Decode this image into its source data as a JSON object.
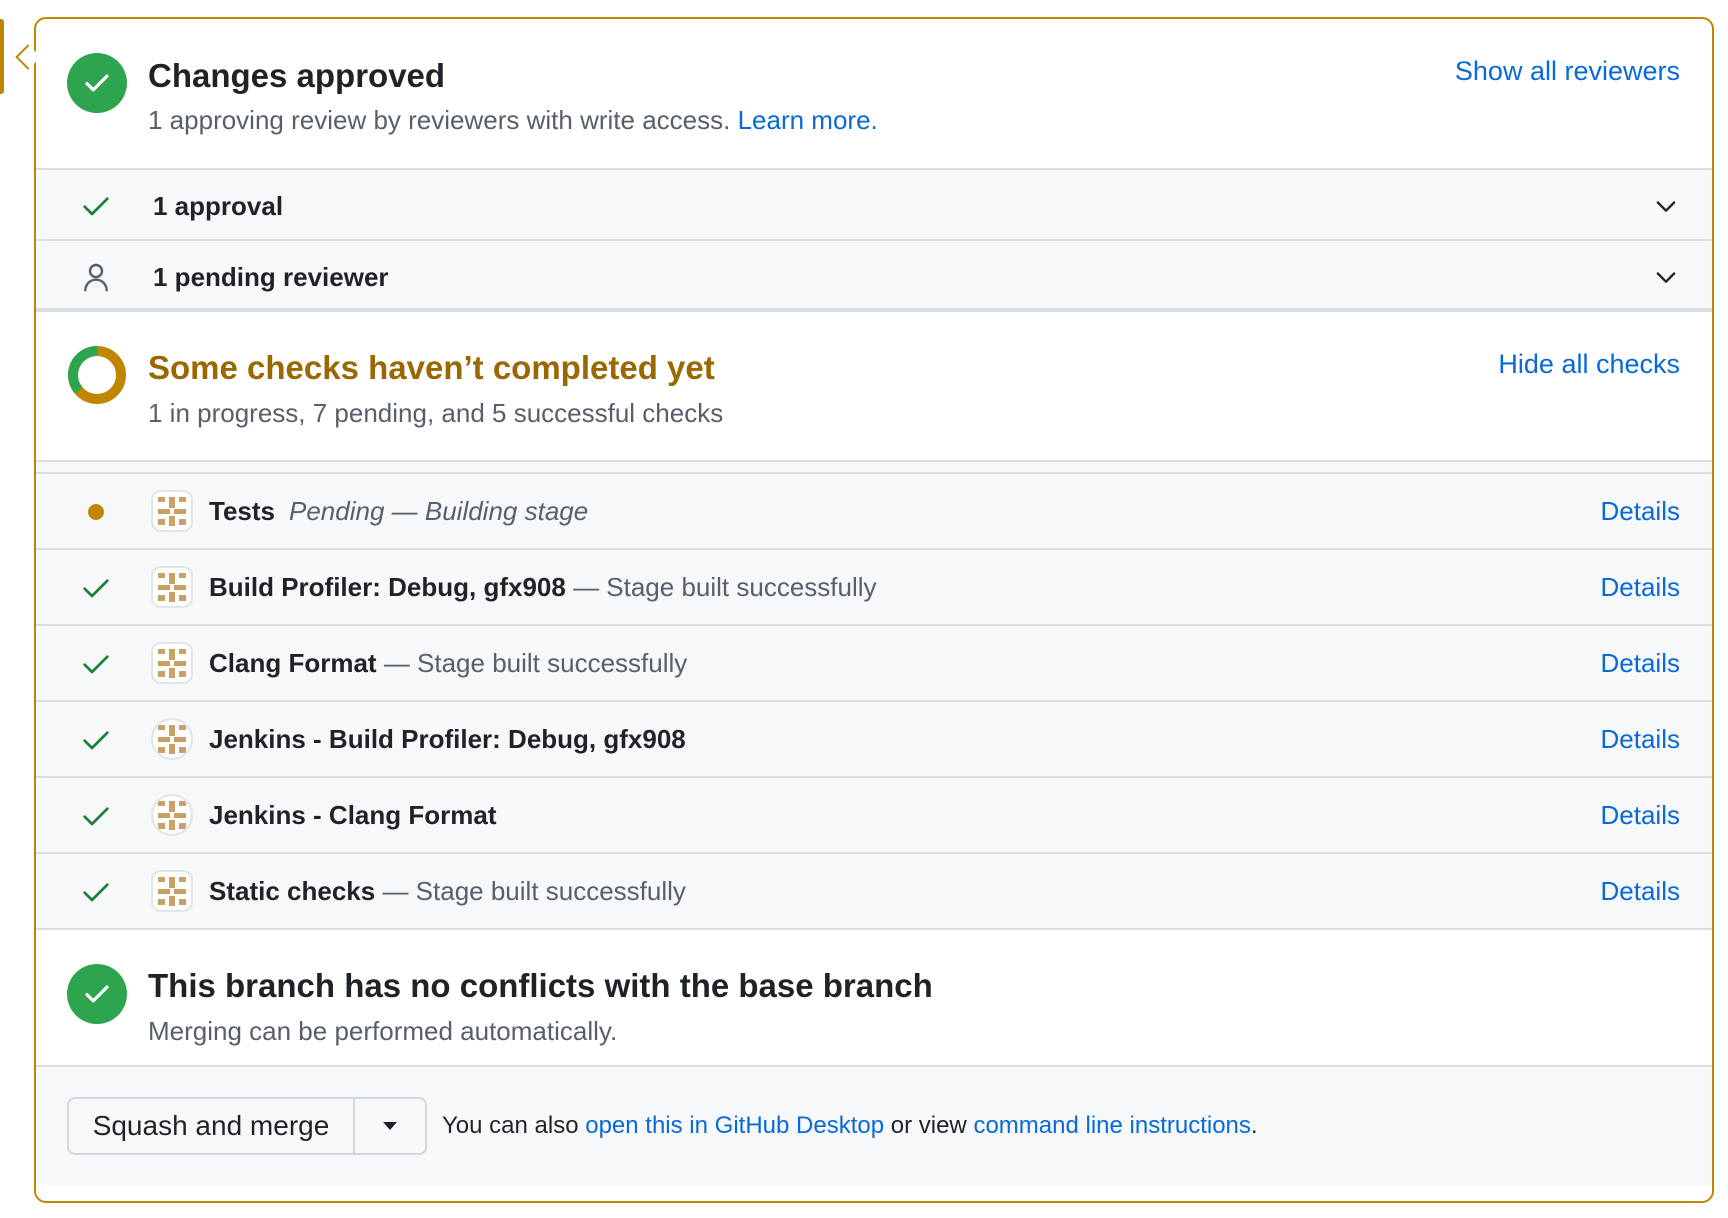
{
  "approvals": {
    "title": "Changes approved",
    "subtitle": "1 approving review by reviewers with write access.",
    "learn_more": "Learn more.",
    "show_all": "Show all reviewers",
    "rows": [
      {
        "label": "1 approval",
        "icon": "check-icon"
      },
      {
        "label": "1 pending reviewer",
        "icon": "person-icon"
      }
    ]
  },
  "checks": {
    "title": "Some checks haven’t completed yet",
    "subtitle": "1 in progress, 7 pending, and 5 successful checks",
    "hide_all": "Hide all checks",
    "items": [
      {
        "name": "Tests",
        "desc": "Pending — Building stage",
        "status": "pending",
        "details": "Details"
      },
      {
        "name": "Build Profiler: Debug, gfx908",
        "desc": "— Stage built successfully",
        "status": "success",
        "details": "Details"
      },
      {
        "name": "Clang Format",
        "desc": "— Stage built successfully",
        "status": "success",
        "details": "Details"
      },
      {
        "name": "Jenkins - Build Profiler: Debug, gfx908",
        "desc": "",
        "status": "success",
        "details": "Details"
      },
      {
        "name": "Jenkins - Clang Format",
        "desc": "",
        "status": "success",
        "details": "Details"
      },
      {
        "name": "Static checks",
        "desc": "— Stage built successfully",
        "status": "success",
        "details": "Details"
      }
    ]
  },
  "merge": {
    "title": "This branch has no conflicts with the base branch",
    "subtitle": "Merging can be performed automatically."
  },
  "footer": {
    "button": "Squash and merge",
    "text_prefix": "You can also",
    "desktop_link": "open this in GitHub Desktop",
    "text_mid": "or view",
    "cli_link": "command line instructions",
    "text_suffix": "."
  },
  "colors": {
    "success": "#2da44e",
    "pending": "#bf8700",
    "link": "#0969da",
    "border": "#bf8700"
  }
}
